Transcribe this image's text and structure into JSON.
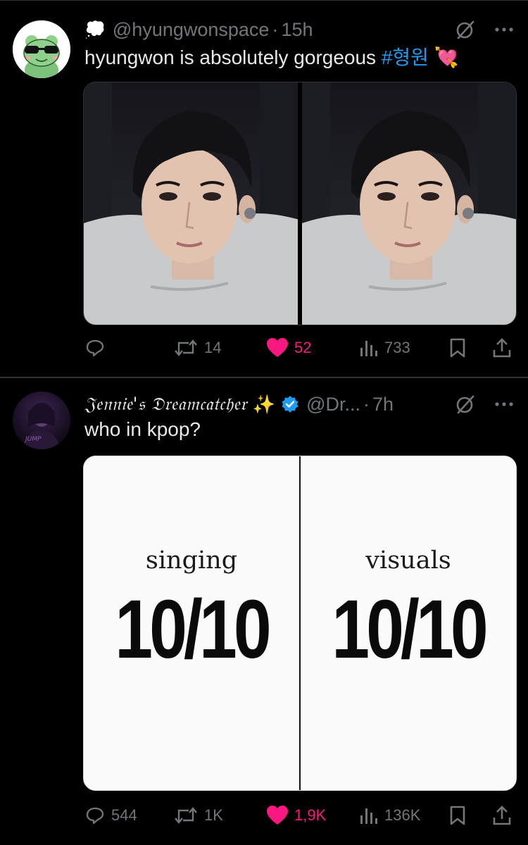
{
  "tweets": [
    {
      "handle": "@hyungwonspace",
      "time": "15h",
      "text": "hyungwon is absolutely gorgeous",
      "hashtag": "#형원",
      "emoji": "💘",
      "status_emoji": "💭",
      "stats": {
        "replies": "",
        "retweets": "14",
        "likes": "52",
        "views": "733"
      }
    },
    {
      "display_name": "𝔍𝔢𝔫𝔫𝔦𝔢'𝔰 𝔇𝔯𝔢𝔞𝔪𝔠𝔞𝔱𝔠𝔥𝔢𝔯",
      "sparkle": "✨",
      "handle": "@Dr...",
      "time": "7h",
      "text": "who in kpop?",
      "card": {
        "left_label": "singing",
        "left_score": "10/10",
        "right_label": "visuals",
        "right_score": "10/10"
      },
      "stats": {
        "replies": "544",
        "retweets": "1K",
        "likes": "1,9K",
        "views": "136K"
      }
    }
  ],
  "colors": {
    "background": "#000000",
    "muted": "#71767b",
    "text": "#e7e9ea",
    "link": "#1d9bf0",
    "like": "#f91880",
    "divider": "#2f3336"
  },
  "icons": {
    "reply": "reply-icon",
    "retweet": "retweet-icon",
    "like": "heart-icon",
    "views": "views-icon",
    "bookmark": "bookmark-icon",
    "share": "share-icon",
    "grok": "grok-icon",
    "more": "more-icon",
    "verified": "verified-badge-icon"
  }
}
